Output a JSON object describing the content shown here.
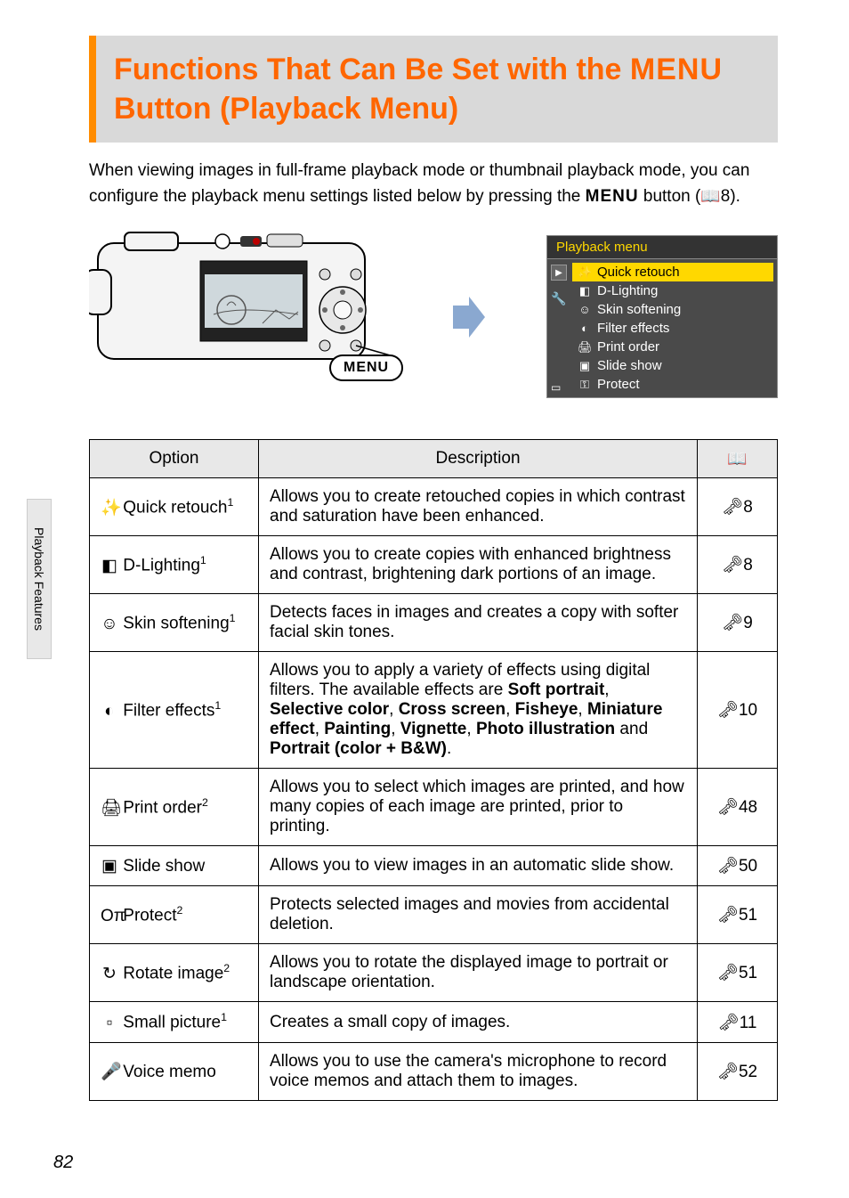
{
  "heading_line1": "Functions That Can Be Set with the ",
  "heading_menu": "MENU",
  "heading_line2": "Button (Playback Menu)",
  "intro_pre": "When viewing images in full-frame playback mode or thumbnail playback mode, you can configure the playback menu settings listed below by pressing the ",
  "intro_menu": "MENU",
  "intro_mid": " button (",
  "intro_ref": "8).",
  "menu_button_label": "MENU",
  "menu_panel": {
    "title": "Playback menu",
    "items": [
      {
        "icon": "✨",
        "label": "Quick retouch",
        "highlighted": true
      },
      {
        "icon": "◧",
        "label": "D-Lighting"
      },
      {
        "icon": "☺",
        "label": "Skin softening"
      },
      {
        "icon": "◐",
        "label": "Filter effects"
      },
      {
        "icon": "🖨",
        "label": "Print order"
      },
      {
        "icon": "▣",
        "label": "Slide show"
      },
      {
        "icon": "⚿",
        "label": "Protect"
      }
    ]
  },
  "table": {
    "headers": {
      "option": "Option",
      "description": "Description",
      "ref": "📖"
    },
    "rows": [
      {
        "icon": "✨",
        "label_a": " Quick retouch",
        "sup": "1",
        "desc": "Allows you to create retouched copies in which contrast and saturation have been enhanced.",
        "ref": "8"
      },
      {
        "icon": "◧",
        "label_a": " D-Lighting",
        "sup": "1",
        "desc": "Allows you to create copies with enhanced brightness and contrast, brightening dark portions of an image.",
        "ref": "8"
      },
      {
        "icon": "☺",
        "label_a": " Skin softening",
        "sup": "1",
        "desc": "Detects faces in images and creates a copy with softer facial skin tones.",
        "ref": "9"
      },
      {
        "icon": "◐",
        "label_a": " Filter effects",
        "sup": "1",
        "desc_pre": "Allows you to apply a variety of effects using digital filters. The available effects are ",
        "desc_bold1": "Soft portrait",
        "desc_mid1": ", ",
        "desc_bold2": "Selective color",
        "desc_mid2": ", ",
        "desc_bold3": "Cross screen",
        "desc_mid3": ", ",
        "desc_bold4": "Fisheye",
        "desc_mid4": ", ",
        "desc_bold5": "Miniature effect",
        "desc_mid5": ", ",
        "desc_bold6": "Painting",
        "desc_mid6": ", ",
        "desc_bold7": "Vignette",
        "desc_mid7": ", ",
        "desc_bold8": "Photo illustration",
        "desc_mid8": " and ",
        "desc_bold9": "Portrait (color + B&W)",
        "desc_post": ".",
        "ref": "10"
      },
      {
        "icon": "🖨",
        "label_a": " Print order",
        "sup": "2",
        "desc": "Allows you to select which images are printed, and how many copies of each image are printed, prior to printing.",
        "ref": "48"
      },
      {
        "icon": "▣",
        "label_a": " Slide show",
        "sup": "",
        "desc": "Allows you to view images in an automatic slide show.",
        "ref": "50"
      },
      {
        "icon": "Oπ",
        "label_a": " Protect",
        "sup": "2",
        "desc": "Protects selected images and movies from accidental deletion.",
        "ref": "51"
      },
      {
        "icon": "↻",
        "label_a": " Rotate image",
        "sup": "2",
        "desc": "Allows you to rotate the displayed image to portrait or landscape orientation.",
        "ref": "51"
      },
      {
        "icon": "▫",
        "label_a": " Small picture",
        "sup": "1",
        "desc": "Creates a small copy of images.",
        "ref": "11"
      },
      {
        "icon": "🎤",
        "label_a": " Voice memo",
        "sup": "",
        "desc": "Allows you to use the camera's microphone to record voice memos and attach them to images.",
        "ref": "52"
      }
    ]
  },
  "sidebar_label": "Playback Features",
  "page_number": "82"
}
